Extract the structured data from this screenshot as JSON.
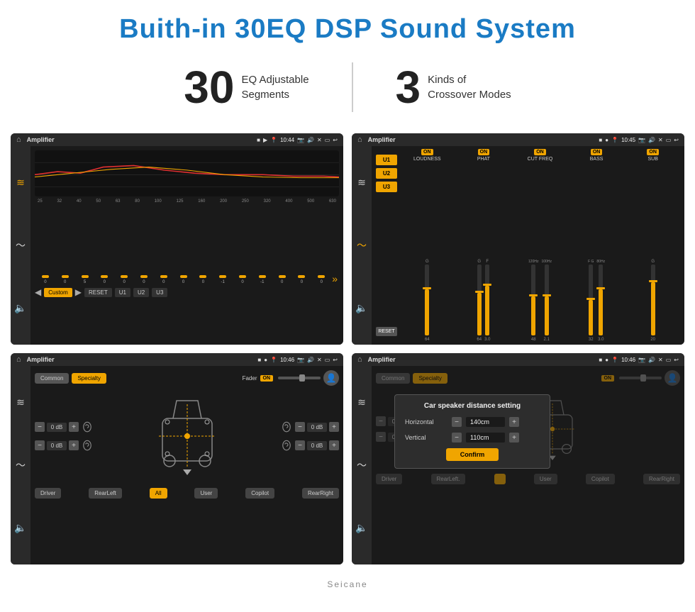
{
  "page": {
    "title": "Buith-in 30EQ DSP Sound System",
    "stat1_number": "30",
    "stat1_label_line1": "EQ Adjustable",
    "stat1_label_line2": "Segments",
    "stat2_number": "3",
    "stat2_label_line1": "Kinds of",
    "stat2_label_line2": "Crossover Modes"
  },
  "screen1": {
    "title": "Amplifier",
    "time": "10:44",
    "freq_labels": [
      "25",
      "32",
      "40",
      "50",
      "63",
      "80",
      "100",
      "125",
      "160",
      "200",
      "250",
      "320",
      "400",
      "500",
      "630"
    ],
    "slider_values": [
      "0",
      "0",
      "5",
      "0",
      "0",
      "0",
      "0",
      "0",
      "0",
      "-1",
      "0",
      "-1"
    ],
    "bottom_buttons": [
      "Custom",
      "RESET",
      "U1",
      "U2",
      "U3"
    ]
  },
  "screen2": {
    "title": "Amplifier",
    "time": "10:45",
    "channels": [
      "LOUDNESS",
      "PHAT",
      "CUT FREQ",
      "BASS",
      "SUB"
    ],
    "presets": [
      "U1",
      "U2",
      "U3"
    ],
    "reset_label": "RESET"
  },
  "screen3": {
    "title": "Amplifier",
    "time": "10:46",
    "mode_buttons": [
      "Common",
      "Specialty"
    ],
    "fader_label": "Fader",
    "on_label": "ON",
    "db_values": [
      "0 dB",
      "0 dB",
      "0 dB",
      "0 dB"
    ],
    "bottom_buttons": [
      "Driver",
      "RearLeft",
      "All",
      "User",
      "Copilot",
      "RearRight"
    ]
  },
  "screen4": {
    "title": "Amplifier",
    "time": "10:46",
    "mode_buttons": [
      "Common",
      "Specialty"
    ],
    "dialog_title": "Car speaker distance setting",
    "horizontal_label": "Horizontal",
    "horizontal_value": "140cm",
    "vertical_label": "Vertical",
    "vertical_value": "110cm",
    "confirm_label": "Confirm",
    "db_values": [
      "0 dB",
      "0 dB"
    ],
    "bottom_buttons": [
      "Driver",
      "RearLeft.",
      "User",
      "Copilot",
      "RearRight"
    ]
  },
  "watermark": "Seicane"
}
